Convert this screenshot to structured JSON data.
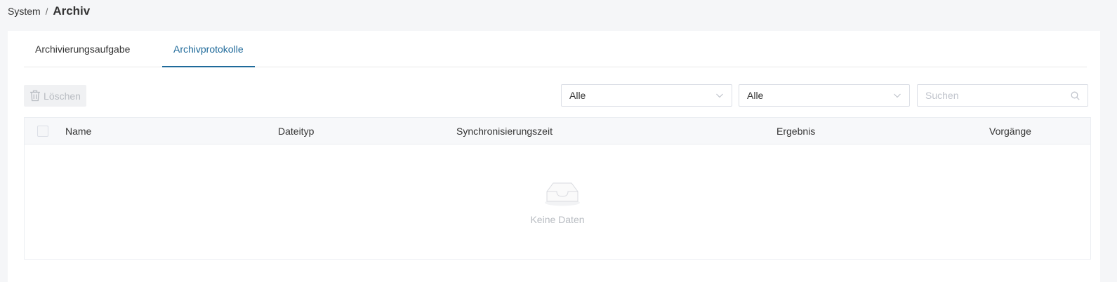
{
  "breadcrumb": {
    "parent": "System",
    "separator": "/",
    "current": "Archiv"
  },
  "tabs": [
    {
      "label": "Archivierungsaufgabe",
      "active": false
    },
    {
      "label": "Archivprotokolle",
      "active": true
    }
  ],
  "toolbar": {
    "delete_label": "Löschen",
    "delete_icon": "trash-icon",
    "filter1_value": "Alle",
    "filter2_value": "Alle",
    "search_placeholder": "Suchen"
  },
  "table": {
    "columns": [
      "Name",
      "Dateityp",
      "Synchronisierungszeit",
      "Ergebnis",
      "Vorgänge"
    ],
    "rows": [],
    "empty_text": "Keine Daten"
  },
  "colors": {
    "accent": "#1f6a9a",
    "muted": "#b8bcc2",
    "background": "#f5f6f8"
  }
}
